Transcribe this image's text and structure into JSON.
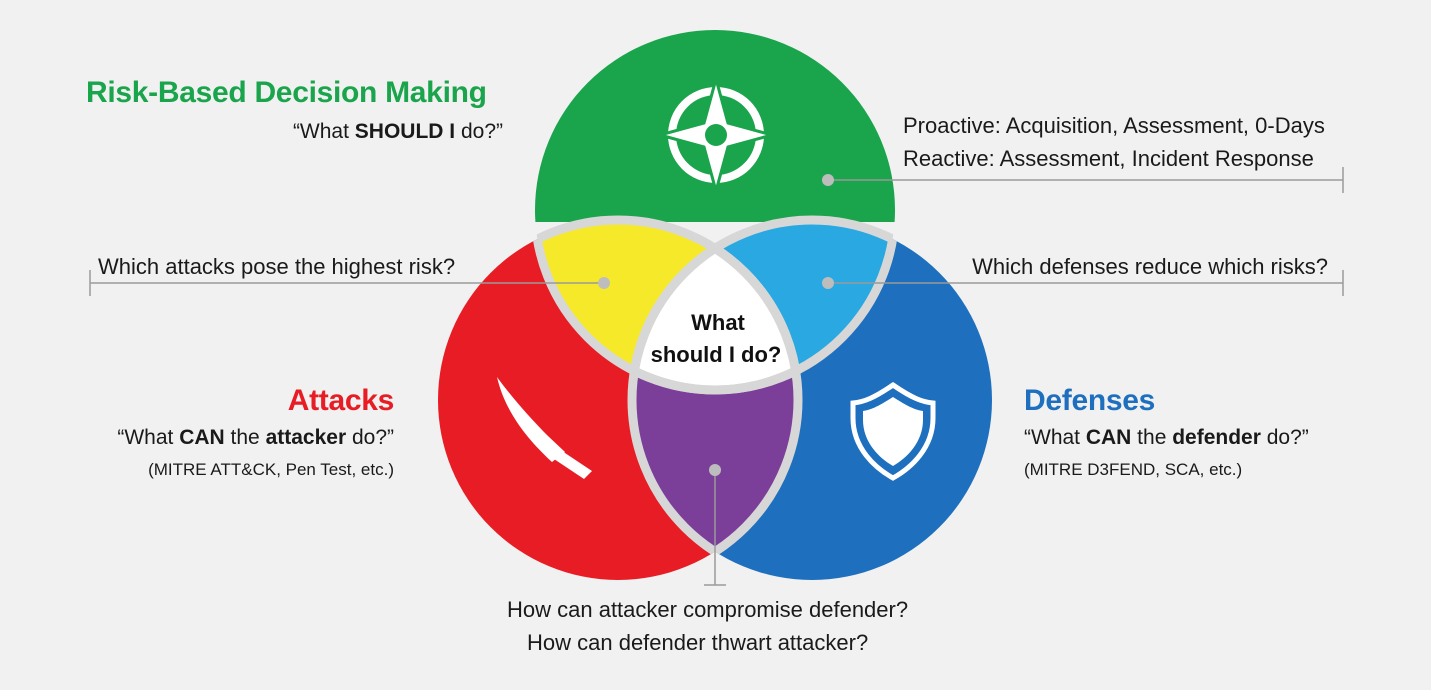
{
  "colors": {
    "background": "#f1f1f1",
    "green": "#1aa44c",
    "red": "#e81c24",
    "blue": "#1f6fbf",
    "yellow": "#f5e92a",
    "light_blue": "#2aa8e2",
    "purple": "#7b3f9a",
    "center": "#ffffff",
    "ring": "#d7d7d7",
    "leader": "#9a9a9a"
  },
  "icons": {
    "top": "compass-icon",
    "left": "knife-icon",
    "right": "shield-icon"
  },
  "center": {
    "line1": "What",
    "line2": "should I do?"
  },
  "risk": {
    "title": "Risk-Based Decision Making",
    "quote_pre": "“What ",
    "quote_bold": "SHOULD I",
    "quote_post": " do?”"
  },
  "attacks": {
    "title": "Attacks",
    "quote_pre": "“What ",
    "quote_bold1": "CAN",
    "quote_mid": " the ",
    "quote_bold2": "attacker",
    "quote_post": " do?”",
    "examples": "(MITRE ATT&CK, Pen Test, etc.)"
  },
  "defenses": {
    "title": "Defenses",
    "quote_pre": "“What ",
    "quote_bold1": "CAN",
    "quote_mid": " the ",
    "quote_bold2": "defender",
    "quote_post": " do?”",
    "examples": "(MITRE D3FEND, SCA, etc.)"
  },
  "callouts": {
    "proactive": "Proactive: Acquisition, Assessment, 0-Days",
    "reactive": "Reactive: Assessment, Incident Response",
    "attacks_risk": "Which attacks pose the highest risk?",
    "defenses_risk": "Which defenses reduce which risks?",
    "bottom1": "How can attacker compromise defender?",
    "bottom2": "How can defender thwart attacker?"
  }
}
